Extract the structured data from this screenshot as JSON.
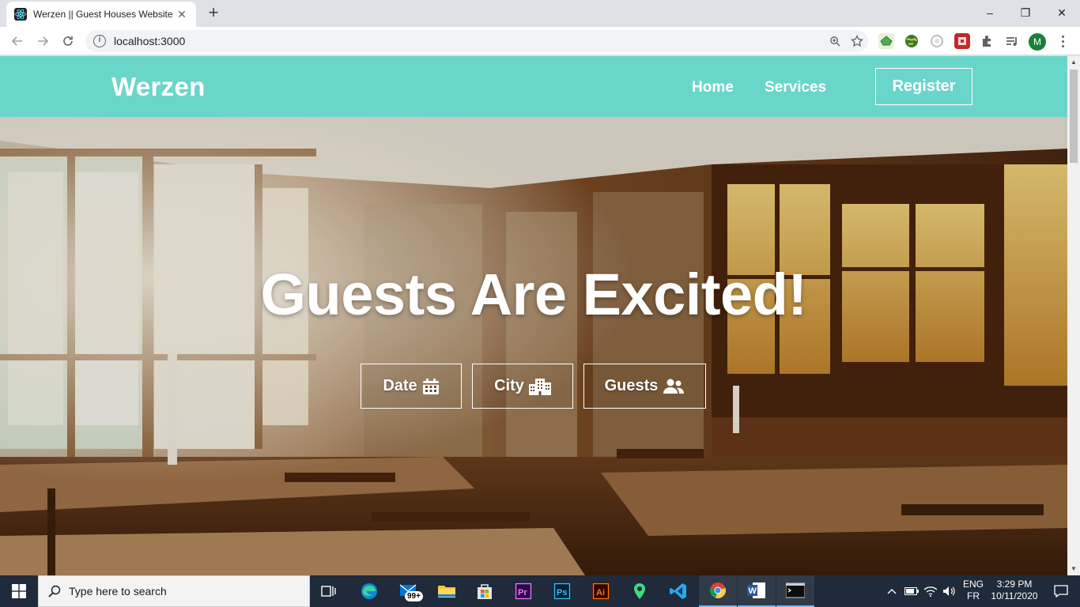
{
  "browser": {
    "tab_title": "Werzen || Guest Houses Website",
    "tab_close": "✕",
    "new_tab": "+",
    "url": "localhost:3000",
    "profile_initial": "M",
    "window_controls": [
      "–",
      "❐",
      "✕"
    ]
  },
  "site": {
    "logo": "Werzen",
    "nav": [
      {
        "label": "Home"
      },
      {
        "label": "Services"
      }
    ],
    "register": "Register",
    "accent_color": "#6ad6c9"
  },
  "hero": {
    "title": "Guests Are Excited!",
    "buttons": [
      {
        "label": "Date",
        "icon": "calendar-icon"
      },
      {
        "label": "City",
        "icon": "city-icon"
      },
      {
        "label": "Guests",
        "icon": "users-icon"
      }
    ]
  },
  "taskbar": {
    "search_placeholder": "Type here to search",
    "mail_badge": "99+",
    "language_top": "ENG",
    "language_bottom": "FR",
    "time": "3:29 PM",
    "date": "10/11/2020"
  }
}
